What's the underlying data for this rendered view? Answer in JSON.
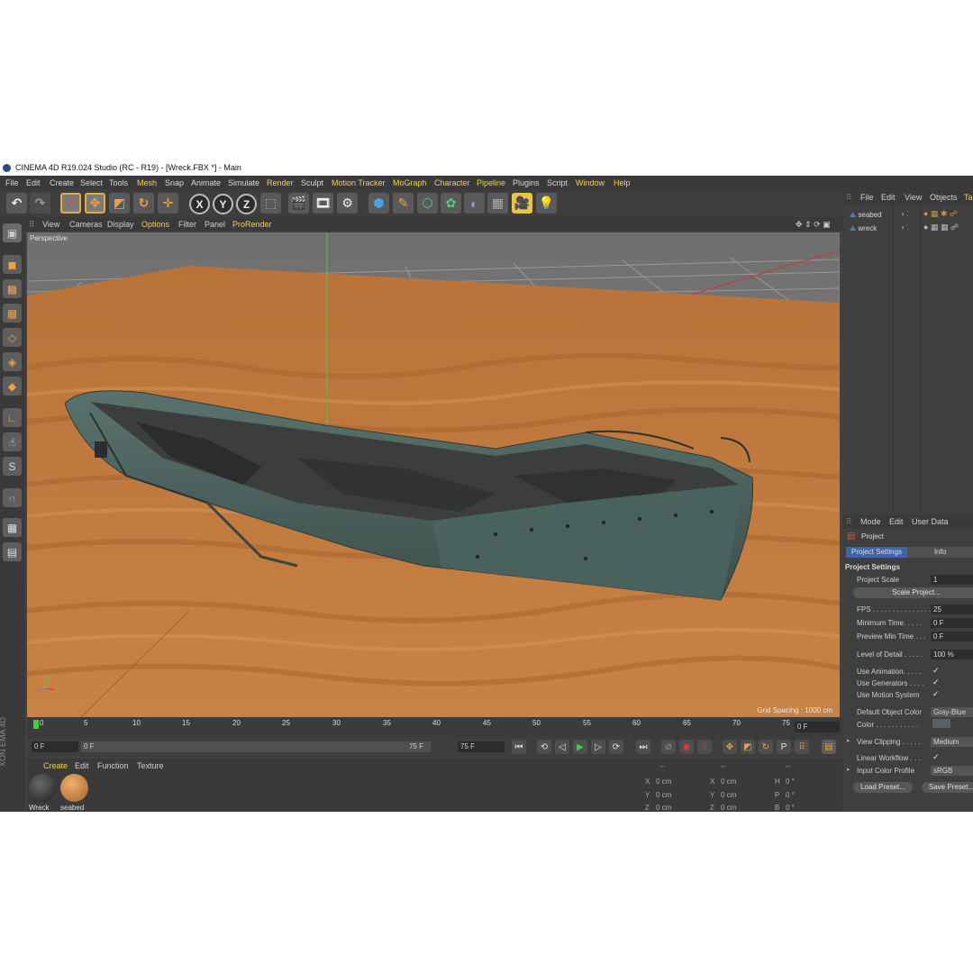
{
  "window": {
    "title": "CINEMA 4D R19.024 Studio (RC - R19) - [Wreck.FBX *] - Main"
  },
  "menubar": {
    "items": [
      "File",
      "Edit",
      "Create",
      "Select",
      "Tools",
      "Mesh",
      "Snap",
      "Animate",
      "Simulate",
      "Render",
      "Sculpt",
      "Motion Tracker",
      "MoGraph",
      "Character",
      "Pipeline",
      "Plugins",
      "Script",
      "Window",
      "Help"
    ]
  },
  "viewport_menu": {
    "items": [
      "View",
      "Cameras",
      "Display",
      "Options",
      "Filter",
      "Panel",
      "ProRender"
    ]
  },
  "viewport": {
    "label": "Perspective",
    "grid_spacing": "Grid Spacing : 1000 cm"
  },
  "timeline": {
    "ticks": [
      "0",
      "5",
      "10",
      "15",
      "20",
      "25",
      "30",
      "35",
      "40",
      "45",
      "50",
      "55",
      "60",
      "65",
      "70",
      "75"
    ],
    "current_frame": "0 F",
    "start": "0 F",
    "range_start": "0 F",
    "range_end": "75 F",
    "end": "75 F"
  },
  "material_manager": {
    "menu": [
      "Create",
      "Edit",
      "Function",
      "Texture"
    ],
    "materials": [
      {
        "name": "Wreck"
      },
      {
        "name": "seabed"
      }
    ]
  },
  "coordinates": {
    "rows": [
      {
        "a": "X",
        "av": "0 cm",
        "b": "X",
        "bv": "0 cm",
        "c": "H",
        "cv": "0 °"
      },
      {
        "a": "Y",
        "av": "0 cm",
        "b": "Y",
        "bv": "0 cm",
        "c": "P",
        "cv": "0 °"
      },
      {
        "a": "Z",
        "av": "0 cm",
        "b": "Z",
        "bv": "0 cm",
        "c": "B",
        "cv": "0 °"
      }
    ],
    "headers": [
      "--",
      "--",
      "--"
    ]
  },
  "object_manager": {
    "menu": [
      "File",
      "Edit",
      "View",
      "Objects",
      "Ta"
    ],
    "objects": [
      {
        "name": "seabed"
      },
      {
        "name": "wreck"
      }
    ]
  },
  "attribute_manager": {
    "menu": [
      "Mode",
      "Edit",
      "User Data"
    ],
    "object_label": "Project",
    "tabs": [
      "Project Settings",
      "Info"
    ],
    "section": "Project Settings",
    "project_scale_label": "Project Scale",
    "project_scale": "1",
    "scale_project_button": "Scale Project...",
    "fps_label": "FPS . . . . . . . . . . . . . . .",
    "fps": "25",
    "min_time_label": "Minimum Time. . . . .",
    "min_time": "0 F",
    "preview_min_label": "Preview Min Time . . .",
    "preview_min": "0 F",
    "lod_label": "Level of Detail . . . . .",
    "lod": "100 %",
    "use_animation": "Use Animation. . . . .",
    "use_generators": "Use Generators . . . .",
    "use_motion": "Use Motion System",
    "default_color_label": "Default Object Color",
    "default_color": "Gray-Blue",
    "color_label": "Color . . . . . . . . . . .",
    "view_clipping_label": "View Clipping . . . . .",
    "view_clipping": "Medium",
    "linear_workflow": "Linear Workflow . . .",
    "input_profile_label": "Input Color Profile",
    "input_profile": "sRGB",
    "load_preset": "Load Preset...",
    "save_preset": "Save Preset...",
    "checkmark": "✓"
  },
  "side_watermark": "XON EMA 4D",
  "colors": {
    "accent": "#f4d14a",
    "ui_bg": "#424242",
    "sand": "#c27a3c",
    "hull": "#4f6863"
  }
}
